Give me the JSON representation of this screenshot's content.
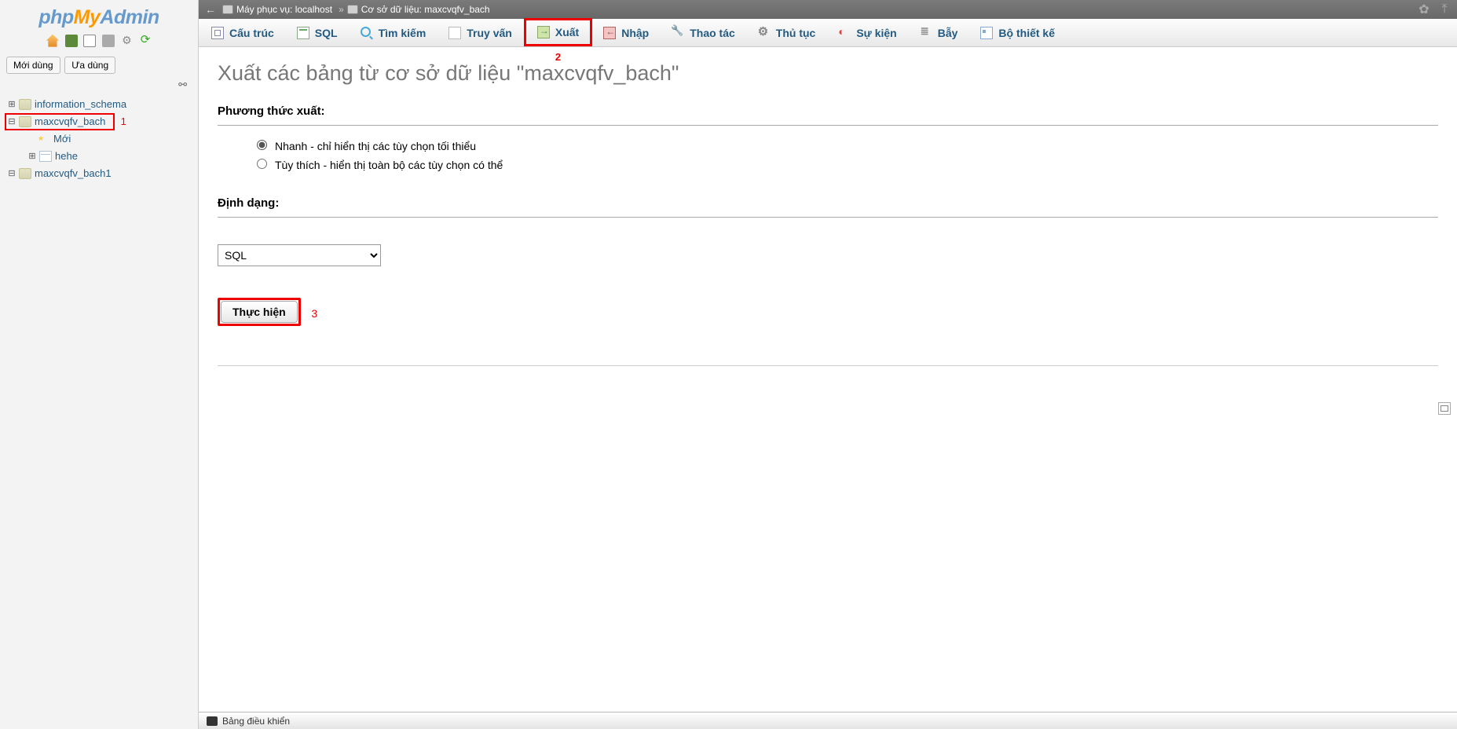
{
  "logo": {
    "p1": "php",
    "p2": "My",
    "p3": "Admin"
  },
  "recent": {
    "mới": "Mới dùng",
    "ua": "Ưa dùng"
  },
  "tree": {
    "db1": "information_schema",
    "db2": "maxcvqfv_bach",
    "db2_new": "Mới",
    "db2_t1": "hehe",
    "db3": "maxcvqfv_bach1"
  },
  "annotations": {
    "a1": "1",
    "a2": "2",
    "a3": "3"
  },
  "breadcrumb": {
    "server_label": "Máy phục vụ: localhost",
    "sep": "»",
    "db_label": "Cơ sở dữ liệu: maxcvqfv_bach"
  },
  "tabs": {
    "structure": "Cấu trúc",
    "sql": "SQL",
    "search": "Tìm kiếm",
    "query": "Truy vấn",
    "export": "Xuất",
    "import": "Nhập",
    "operations": "Thao tác",
    "procedures": "Thủ tục",
    "events": "Sự kiện",
    "triggers": "Bẫy",
    "designer": "Bộ thiết kế"
  },
  "page": {
    "title": "Xuất các bảng từ cơ sở dữ liệu \"maxcvqfv_bach\"",
    "method_heading": "Phương thức xuất:",
    "opt_quick": "Nhanh - chỉ hiển thị các tùy chọn tối thiểu",
    "opt_custom": "Tùy thích - hiển thị toàn bộ các tùy chọn có thể",
    "format_heading": "Định dạng:",
    "format_value": "SQL",
    "go": "Thực hiện"
  },
  "console": {
    "label": "Bảng điều khiển"
  }
}
